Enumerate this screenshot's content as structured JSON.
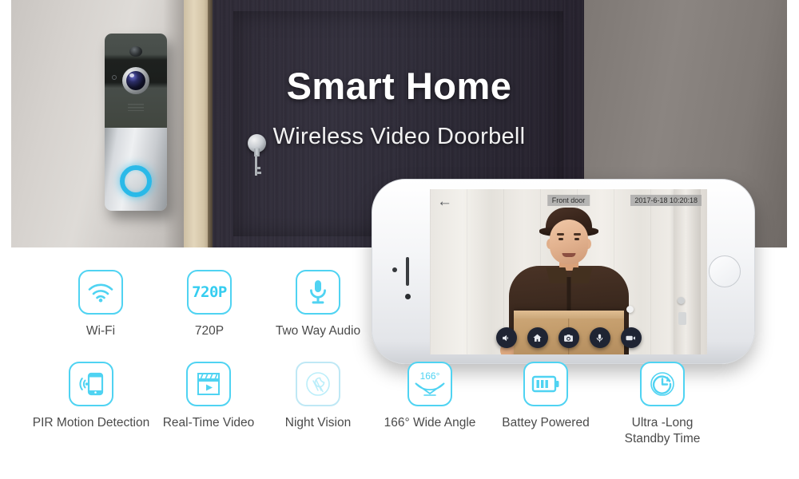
{
  "hero": {
    "title": "Smart Home",
    "subtitle": "Wireless Video Doorbell",
    "device_name": "wifi-video-doorbell",
    "accent_color": "#2ab9e8"
  },
  "phone": {
    "screen": {
      "back_icon": "←",
      "camera_label": "Front door",
      "timestamp": "2017-6-18 10:20:18",
      "controls": [
        {
          "name": "speaker-button",
          "icon": "speaker-icon"
        },
        {
          "name": "home-button",
          "icon": "home-icon"
        },
        {
          "name": "snapshot-button",
          "icon": "camera-icon"
        },
        {
          "name": "microphone-button",
          "icon": "microphone-icon"
        },
        {
          "name": "record-button",
          "icon": "video-camera-icon"
        }
      ]
    }
  },
  "features": {
    "accent_color": "#4fd3f2",
    "label_color": "#4a4a4a",
    "row1": [
      {
        "label": "Wi-Fi",
        "icon": "wifi-icon"
      },
      {
        "label": "720P",
        "icon": "resolution-720p-icon",
        "icon_text": "720P"
      },
      {
        "label": "Two Way Audio",
        "icon": "microphone-icon"
      }
    ],
    "row2": [
      {
        "label": "PIR Motion Detection",
        "icon": "phone-motion-alert-icon"
      },
      {
        "label": "Real-Time Video",
        "icon": "video-play-icon"
      },
      {
        "label": "Night Vision",
        "icon": "night-vision-icon"
      },
      {
        "label": "166° Wide Angle",
        "icon": "wide-angle-icon",
        "icon_text": "166°"
      },
      {
        "label": "Battey Powered",
        "icon": "battery-icon"
      },
      {
        "label": "Ultra -Long\nStandby Time",
        "icon": "clock-refresh-icon"
      }
    ]
  }
}
